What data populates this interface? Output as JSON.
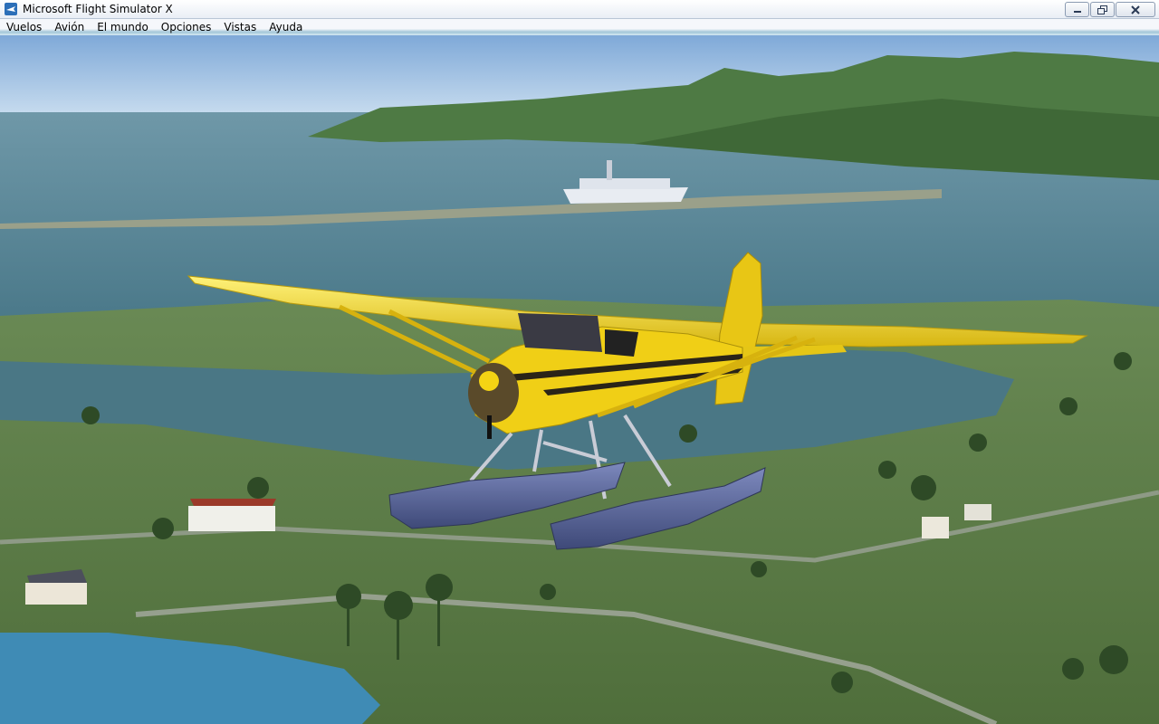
{
  "window": {
    "title": "Microsoft Flight Simulator X"
  },
  "menu": {
    "items": [
      {
        "label": "Vuelos"
      },
      {
        "label": "Avión"
      },
      {
        "label": "El mundo"
      },
      {
        "label": "Opciones"
      },
      {
        "label": "Vistas"
      },
      {
        "label": "Ayuda"
      }
    ]
  },
  "colors": {
    "sky": "#8fb8e0",
    "sea": "#4f7e8c",
    "land": "#5c7a44",
    "aircraft": "#f2d21b",
    "floats": "#5b6aa0"
  }
}
